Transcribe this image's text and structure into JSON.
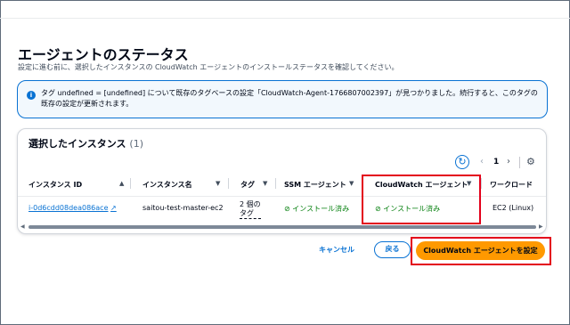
{
  "page": {
    "title": "エージェントのステータス",
    "description": "設定に進む前に、選択したインスタンスの CloudWatch エージェントのインストールステータスを確認してください。"
  },
  "alert": {
    "text": "タグ undefined = [undefined] について既存のタグベースの設定「CloudWatch-Agent-1766807002397」が見つかりました。続行すると、このタグの既存の設定が更新されます。",
    "icon": "info-icon",
    "color": "#0972d3"
  },
  "table": {
    "title": "選択したインスタンス",
    "count": "(1)",
    "page_number": "1",
    "columns": {
      "instance_id": "インスタンス ID",
      "instance_name": "インスタンス名",
      "tag": "タグ",
      "ssm_agent": "SSM エージェント",
      "cloudwatch_agent": "CloudWatch エージェント",
      "workload": "ワークロード"
    },
    "rows": [
      {
        "instance_id": "i-0d6cdd08dea086ace",
        "instance_name": "saitou-test-master-ec2",
        "tag": "2 個の タグ",
        "ssm_agent": "インストール済み",
        "cloudwatch_agent": "インストール済み",
        "workload": "EC2 (Linux)"
      }
    ]
  },
  "actions": {
    "cancel": "キャンセル",
    "back": "戻る",
    "configure": "CloudWatch エージェントを設定"
  },
  "colors": {
    "link": "#0972d3",
    "success": "#037f0c",
    "primary": "#ff9900",
    "highlight": "#e3001b"
  }
}
